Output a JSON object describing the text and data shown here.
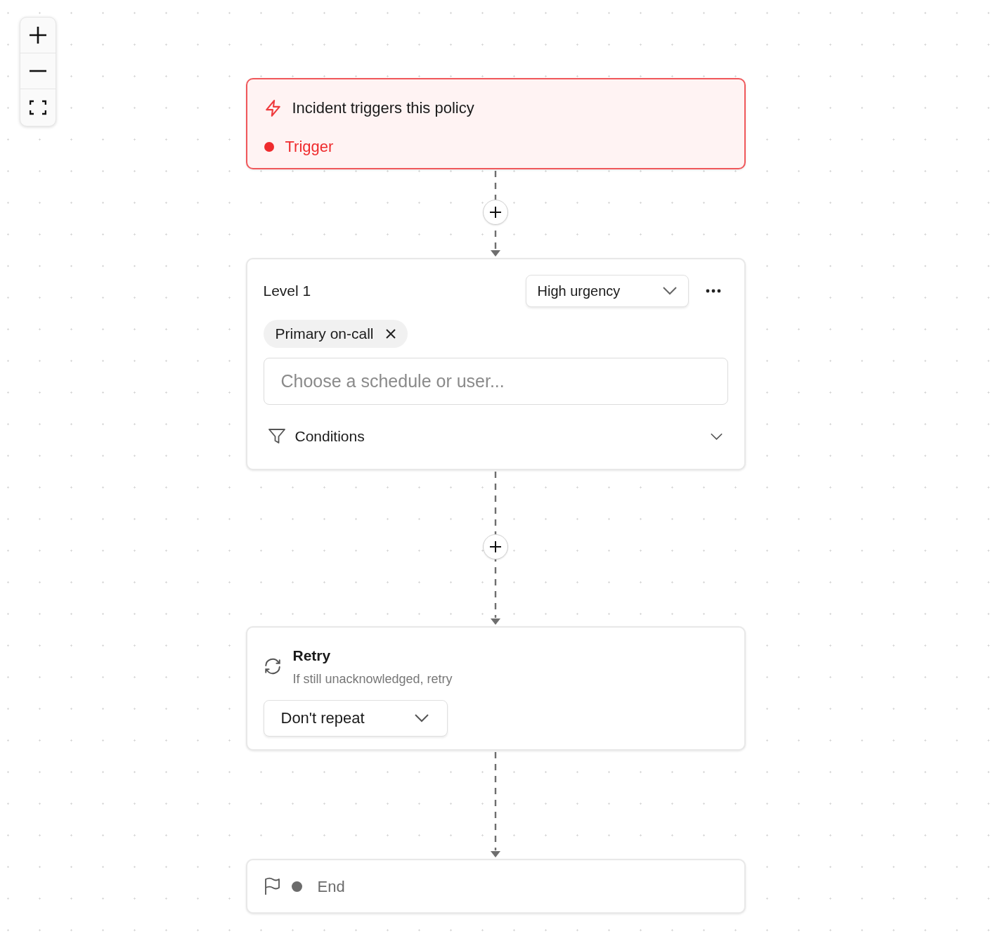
{
  "flow": [
    {
      "kind": "trigger",
      "title": "Incident triggers this policy",
      "status": "Trigger",
      "color": "#ef2b2d"
    },
    {
      "kind": "connector",
      "add_button": true
    },
    {
      "kind": "level",
      "title": "Level 1",
      "urgency": "High urgency",
      "targets": [
        {
          "label": "Primary on-call"
        }
      ],
      "placeholder": "Choose a schedule or user...",
      "conditions": {
        "label": "Conditions",
        "expanded": false
      }
    },
    {
      "kind": "connector",
      "add_button": true
    },
    {
      "kind": "retry",
      "title": "Retry",
      "subtitle": "If still unacknowledged, retry",
      "repeat": "Don't repeat"
    },
    {
      "kind": "connector",
      "add_button": false
    },
    {
      "kind": "end",
      "label": "End",
      "color": "#6b6b6b"
    }
  ]
}
